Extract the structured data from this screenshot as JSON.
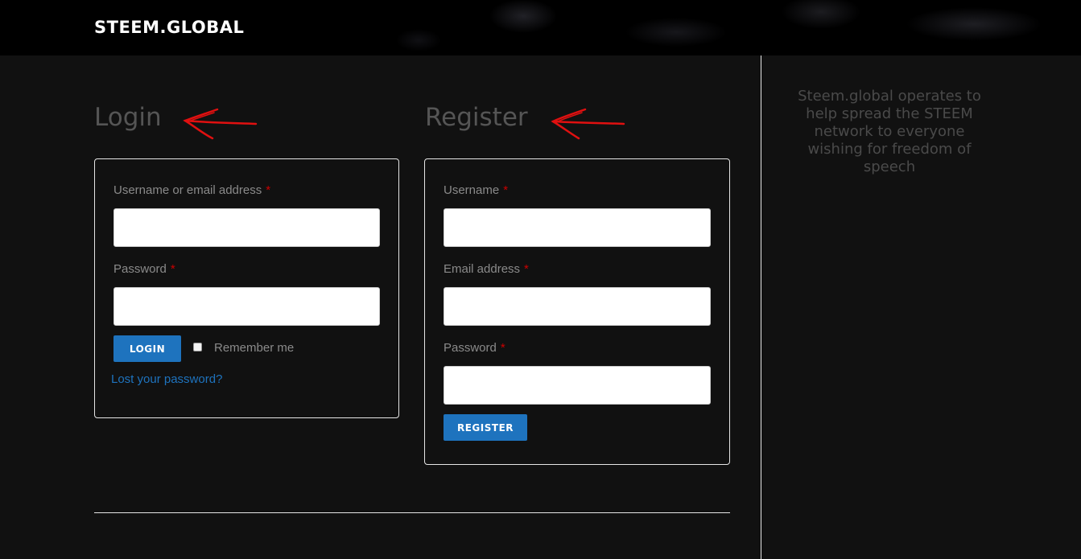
{
  "header": {
    "brand": "STEEM.GLOBAL"
  },
  "sidebar": {
    "tagline": "Steem.global operates to help spread the STEEM network to everyone wishing for freedom of speech"
  },
  "login": {
    "title": "Login",
    "username_label": "Username or email address",
    "password_label": "Password",
    "required_mark": "*",
    "username_value": "",
    "password_value": "",
    "button_label": "LOGIN",
    "remember_label": "Remember me",
    "remember_checked": false,
    "lost_password_link": "Lost your password?"
  },
  "register": {
    "title": "Register",
    "username_label": "Username",
    "email_label": "Email address",
    "password_label": "Password",
    "required_mark": "*",
    "username_value": "",
    "email_value": "",
    "password_value": "",
    "button_label": "REGISTER"
  },
  "colors": {
    "background": "#111111",
    "accent": "#1e73be",
    "required": "#cc0000",
    "annotation_arrow": "#e01010"
  },
  "icons": {
    "annotation": "red-arrow-icon"
  }
}
